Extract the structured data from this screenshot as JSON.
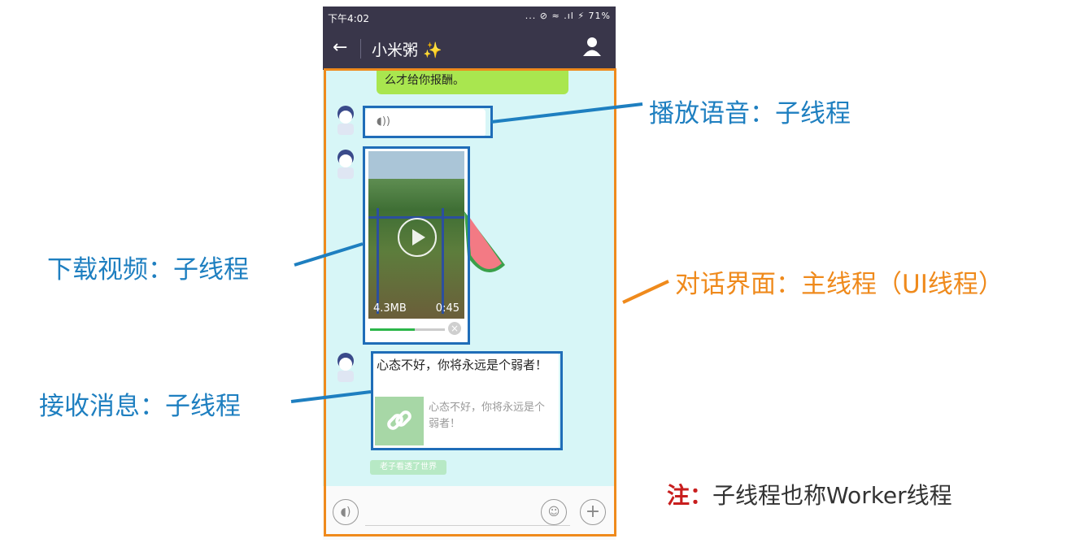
{
  "status_bar": {
    "time": "下午4:02",
    "battery": "71%",
    "icons": "... ⊘ ≈ .ıl ⚡"
  },
  "header": {
    "back_label": "←",
    "title": "小米粥 ✨"
  },
  "chat": {
    "top_message": "么才给你报酬。",
    "video": {
      "size": "4.3MB",
      "duration": "0:45",
      "progress": 0.6
    },
    "text_message": "心态不好，你将永远是个弱者！",
    "link_preview_text": "心态不好，你将永远是个弱者！",
    "chip_label": "老子看透了世界"
  },
  "annotations": {
    "voice": "播放语音：子线程",
    "video": "下载视频：子线程",
    "message": "接收消息：子线程",
    "main": "对话界面：主线程（UI线程）",
    "note_prefix": "注：",
    "note_text": "子线程也称Worker线程"
  },
  "colors": {
    "annotation_blue": "#1e7fc0",
    "annotation_orange": "#ef8a1c",
    "note_red": "#c81e1e"
  }
}
